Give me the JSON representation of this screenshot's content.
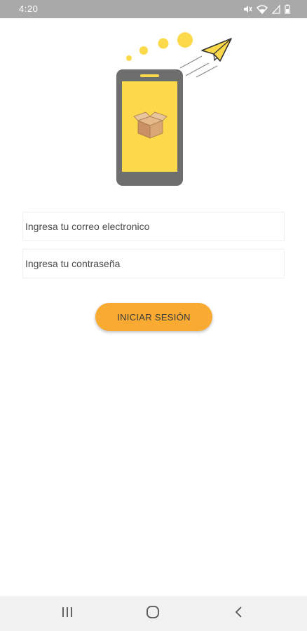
{
  "status_bar": {
    "time": "4:20",
    "icons": [
      "mute-icon",
      "wifi-icon",
      "signal-icon",
      "battery-icon"
    ]
  },
  "illustration": {
    "description_icons": [
      "phone-icon",
      "box-icon",
      "paper-plane-icon"
    ],
    "colors": {
      "screen": "#fcd94a",
      "phone_body": "#6e6e6e",
      "dots": "#fcd94a"
    }
  },
  "login_form": {
    "email_placeholder": "Ingresa tu correo electronico",
    "password_placeholder": "Ingresa tu contraseña",
    "submit_label": "INICIAR SESIÓN"
  },
  "colors": {
    "accent": "#f8aa32",
    "status_bar": "#a9a9a9",
    "nav_bar": "#f1f1f1"
  },
  "nav_bar": {
    "buttons": [
      "recents-icon",
      "home-icon",
      "back-icon"
    ]
  }
}
